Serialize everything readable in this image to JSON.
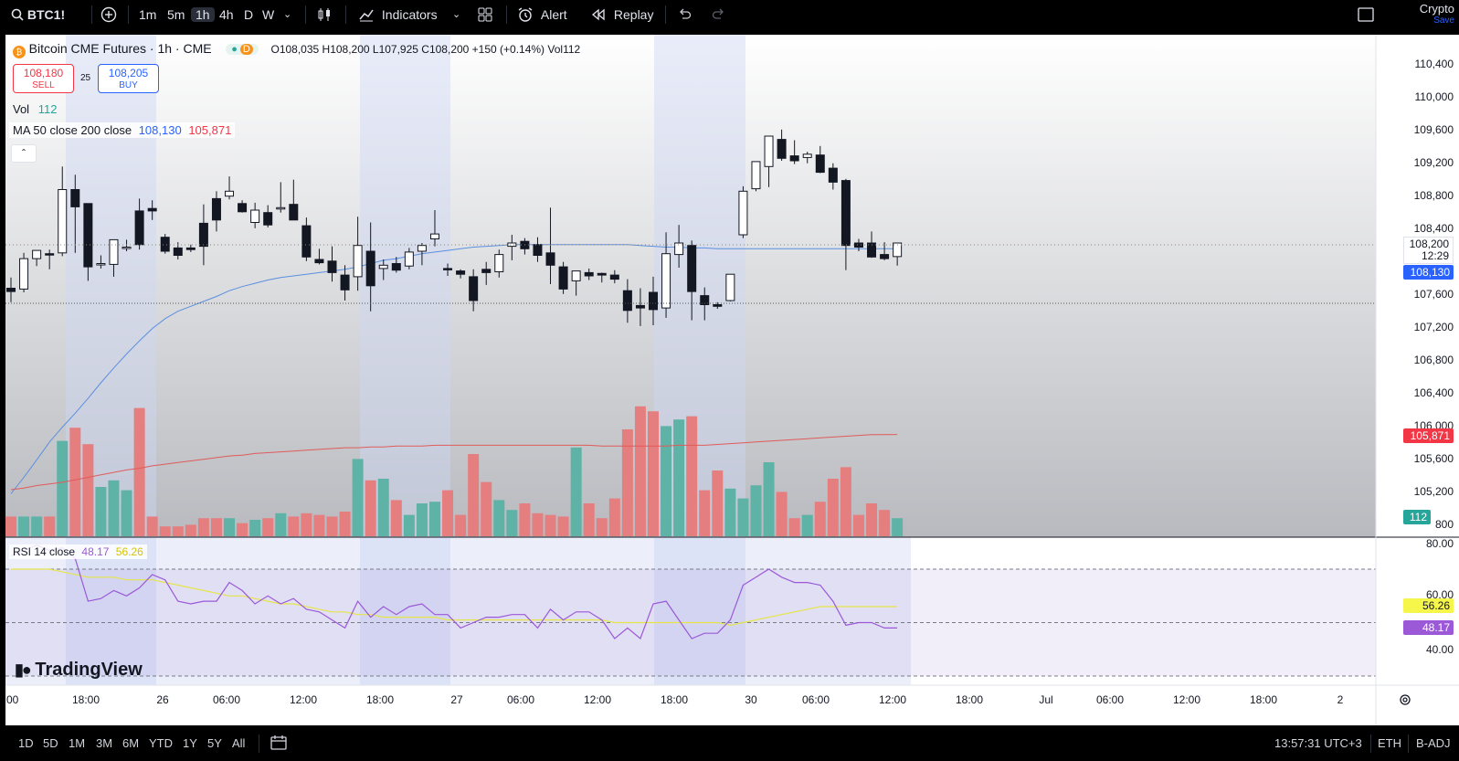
{
  "toolbar": {
    "symbol": "BTC1!",
    "timeframes": [
      "1m",
      "5m",
      "1h",
      "4h",
      "D",
      "W"
    ],
    "active_timeframe": "1h",
    "indicators_label": "Indicators",
    "alert_label": "Alert",
    "replay_label": "Replay",
    "crypto_label": "Crypto",
    "save_label": "Save"
  },
  "legend": {
    "title": "Bitcoin CME Futures · 1h · CME",
    "market_status": "D",
    "ohlc": "O108,035  H108,200  L107,925  C108,200  +150 (+0.14%)  Vol112",
    "sell_price": "108,180",
    "sell_label": "SELL",
    "spread": "25",
    "buy_price": "108,205",
    "buy_label": "BUY",
    "vol_label": "Vol",
    "vol_value": "112",
    "ma_label": "MA 50 close 200 close",
    "ma50_value": "108,130",
    "ma200_value": "105,871",
    "rsi_label": "RSI 14 close",
    "rsi_value": "48.17",
    "rsi_ma_value": "56.26"
  },
  "watermark": "TradingView",
  "price_axis": {
    "labels": [
      "110,400",
      "110,000",
      "109,600",
      "109,200",
      "108,800",
      "108,400",
      "107,600",
      "107,200",
      "106,800",
      "106,400",
      "106,000",
      "105,600",
      "105,200",
      "800"
    ],
    "last_price": "108,200",
    "countdown": "12:29",
    "ma50_tag": "108,130",
    "ma200_tag": "105,871",
    "vol_tag": "112"
  },
  "rsi_axis": {
    "labels": [
      "80.00",
      "60.00",
      "40.00"
    ],
    "rsi_ma_tag": "56.26",
    "rsi_tag": "48.17"
  },
  "time_axis": {
    "labels": [
      ":00",
      "18:00",
      "26",
      "06:00",
      "12:00",
      "18:00",
      "27",
      "06:00",
      "12:00",
      "18:00",
      "30",
      "06:00",
      "12:00",
      "18:00",
      "Jul",
      "06:00",
      "12:00",
      "18:00",
      "2"
    ]
  },
  "bottom": {
    "ranges": [
      "1D",
      "5D",
      "1M",
      "3M",
      "6M",
      "YTD",
      "1Y",
      "5Y",
      "All"
    ],
    "clock": "13:57:31 UTC+3",
    "session": "ETH",
    "adjust": "B-ADJ"
  },
  "colors": {
    "up_volume": "#5fb3a6",
    "down_volume": "#e57f7f",
    "ma50": "#5b8fe0",
    "ma200": "#e05b5b",
    "rsi": "#9b59d8",
    "rsi_ma": "#e5e54a"
  },
  "chart_data": {
    "type": "candlestick",
    "title": "Bitcoin CME Futures · 1h · CME",
    "ylim": [
      105800,
      110600
    ],
    "candles": [
      {
        "o": 107650,
        "h": 107780,
        "l": 107480,
        "c": 107610
      },
      {
        "o": 107640,
        "h": 108080,
        "l": 107600,
        "c": 108010
      },
      {
        "o": 108010,
        "h": 108100,
        "l": 107920,
        "c": 108110
      },
      {
        "o": 108070,
        "h": 108120,
        "l": 107880,
        "c": 108060
      },
      {
        "o": 108080,
        "h": 109130,
        "l": 108040,
        "c": 108850
      },
      {
        "o": 108850,
        "h": 109030,
        "l": 108080,
        "c": 108640
      },
      {
        "o": 108680,
        "h": 108650,
        "l": 107740,
        "c": 107910
      },
      {
        "o": 107940,
        "h": 108050,
        "l": 107890,
        "c": 107950
      },
      {
        "o": 107940,
        "h": 108170,
        "l": 107790,
        "c": 108240
      },
      {
        "o": 108150,
        "h": 108240,
        "l": 108100,
        "c": 108150
      },
      {
        "o": 108590,
        "h": 108740,
        "l": 108120,
        "c": 108180
      },
      {
        "o": 108620,
        "h": 108720,
        "l": 108480,
        "c": 108590
      },
      {
        "o": 108270,
        "h": 108310,
        "l": 108070,
        "c": 108100
      },
      {
        "o": 108140,
        "h": 108210,
        "l": 108000,
        "c": 108050
      },
      {
        "o": 108140,
        "h": 108180,
        "l": 108090,
        "c": 108120
      },
      {
        "o": 108440,
        "h": 108670,
        "l": 107930,
        "c": 108160
      },
      {
        "o": 108740,
        "h": 108830,
        "l": 108340,
        "c": 108480
      },
      {
        "o": 108770,
        "h": 109010,
        "l": 108730,
        "c": 108830
      },
      {
        "o": 108680,
        "h": 108720,
        "l": 108570,
        "c": 108580
      },
      {
        "o": 108450,
        "h": 108690,
        "l": 108380,
        "c": 108600
      },
      {
        "o": 108570,
        "h": 108660,
        "l": 108390,
        "c": 108420
      },
      {
        "o": 108620,
        "h": 108940,
        "l": 108570,
        "c": 108630
      },
      {
        "o": 108670,
        "h": 108970,
        "l": 108580,
        "c": 108480
      },
      {
        "o": 108410,
        "h": 108510,
        "l": 107980,
        "c": 108030
      },
      {
        "o": 108000,
        "h": 108130,
        "l": 107940,
        "c": 107960
      },
      {
        "o": 107980,
        "h": 108160,
        "l": 107730,
        "c": 107840
      },
      {
        "o": 107810,
        "h": 107930,
        "l": 107500,
        "c": 107630
      },
      {
        "o": 107790,
        "h": 108520,
        "l": 107620,
        "c": 108170
      },
      {
        "o": 108100,
        "h": 108450,
        "l": 107370,
        "c": 107680
      },
      {
        "o": 107890,
        "h": 108000,
        "l": 107750,
        "c": 107930
      },
      {
        "o": 107950,
        "h": 108030,
        "l": 107840,
        "c": 107870
      },
      {
        "o": 107920,
        "h": 108140,
        "l": 107880,
        "c": 108090
      },
      {
        "o": 108100,
        "h": 108200,
        "l": 107930,
        "c": 108170
      },
      {
        "o": 108250,
        "h": 108600,
        "l": 108160,
        "c": 108310
      },
      {
        "o": 107890,
        "h": 107950,
        "l": 107800,
        "c": 107880
      },
      {
        "o": 107860,
        "h": 107880,
        "l": 107770,
        "c": 107820
      },
      {
        "o": 107790,
        "h": 107880,
        "l": 107370,
        "c": 107500
      },
      {
        "o": 107880,
        "h": 107970,
        "l": 107690,
        "c": 107840
      },
      {
        "o": 107850,
        "h": 108120,
        "l": 107780,
        "c": 108060
      },
      {
        "o": 108160,
        "h": 108300,
        "l": 107990,
        "c": 108200
      },
      {
        "o": 108220,
        "h": 108260,
        "l": 108060,
        "c": 108130
      },
      {
        "o": 108180,
        "h": 108270,
        "l": 107970,
        "c": 108050
      },
      {
        "o": 108080,
        "h": 108630,
        "l": 107700,
        "c": 107930
      },
      {
        "o": 107910,
        "h": 107970,
        "l": 107580,
        "c": 107640
      },
      {
        "o": 107740,
        "h": 107760,
        "l": 107560,
        "c": 107860
      },
      {
        "o": 107840,
        "h": 107890,
        "l": 107750,
        "c": 107800
      },
      {
        "o": 107830,
        "h": 107840,
        "l": 107720,
        "c": 107810
      },
      {
        "o": 107810,
        "h": 107870,
        "l": 107710,
        "c": 107760
      },
      {
        "o": 107620,
        "h": 107760,
        "l": 107230,
        "c": 107380
      },
      {
        "o": 107440,
        "h": 107650,
        "l": 107190,
        "c": 107410
      },
      {
        "o": 107600,
        "h": 107790,
        "l": 107200,
        "c": 107390
      },
      {
        "o": 107410,
        "h": 108330,
        "l": 107290,
        "c": 108070
      },
      {
        "o": 108060,
        "h": 108420,
        "l": 107900,
        "c": 108200
      },
      {
        "o": 108170,
        "h": 108230,
        "l": 107260,
        "c": 107610
      },
      {
        "o": 107560,
        "h": 107660,
        "l": 107260,
        "c": 107450
      },
      {
        "o": 107450,
        "h": 107480,
        "l": 107400,
        "c": 107430
      },
      {
        "o": 107500,
        "h": 107750,
        "l": 107490,
        "c": 107820
      },
      {
        "o": 108300,
        "h": 108890,
        "l": 108260,
        "c": 108830
      },
      {
        "o": 108860,
        "h": 109180,
        "l": 108830,
        "c": 109190
      },
      {
        "o": 109130,
        "h": 109500,
        "l": 108880,
        "c": 109500
      },
      {
        "o": 109460,
        "h": 109580,
        "l": 109200,
        "c": 109230
      },
      {
        "o": 109260,
        "h": 109450,
        "l": 109160,
        "c": 109200
      },
      {
        "o": 109240,
        "h": 109310,
        "l": 109170,
        "c": 109280
      },
      {
        "o": 109270,
        "h": 109380,
        "l": 109050,
        "c": 109060
      },
      {
        "o": 109110,
        "h": 109170,
        "l": 108850,
        "c": 108940
      },
      {
        "o": 108960,
        "h": 108980,
        "l": 107870,
        "c": 108170
      },
      {
        "o": 108200,
        "h": 108250,
        "l": 108100,
        "c": 108150
      },
      {
        "o": 108200,
        "h": 108340,
        "l": 108020,
        "c": 108030
      },
      {
        "o": 108060,
        "h": 108210,
        "l": 107990,
        "c": 108010
      },
      {
        "o": 108035,
        "h": 108200,
        "l": 107925,
        "c": 108200
      }
    ],
    "volume": [
      12,
      12,
      12,
      12,
      58,
      66,
      56,
      30,
      34,
      28,
      78,
      12,
      6,
      6,
      7,
      11,
      11,
      11,
      8,
      10,
      11,
      14,
      12,
      14,
      13,
      12,
      15,
      47,
      34,
      35,
      22,
      13,
      20,
      21,
      28,
      13,
      50,
      33,
      22,
      16,
      20,
      14,
      13,
      12,
      54,
      20,
      11,
      23,
      65,
      79,
      76,
      67,
      71,
      73,
      28,
      40,
      29,
      23,
      31,
      45,
      27,
      11,
      13,
      21,
      35,
      42,
      13,
      20,
      16,
      11
    ],
    "ma50": [
      105150,
      105350,
      105560,
      105780,
      105960,
      106130,
      106310,
      106500,
      106680,
      106850,
      107010,
      107160,
      107280,
      107370,
      107430,
      107490,
      107550,
      107620,
      107670,
      107710,
      107750,
      107780,
      107800,
      107820,
      107840,
      107860,
      107880,
      107910,
      107950,
      107990,
      108010,
      108040,
      108070,
      108090,
      108110,
      108130,
      108150,
      108160,
      108170,
      108180,
      108180,
      108180,
      108180,
      108180,
      108180,
      108180,
      108180,
      108180,
      108180,
      108170,
      108160,
      108150,
      108150,
      108140,
      108140,
      108130,
      108130,
      108130,
      108130,
      108130,
      108130,
      108130,
      108130,
      108130,
      108130,
      108130,
      108130,
      108130,
      108130,
      108130
    ],
    "ma200": [
      105200,
      105220,
      105250,
      105270,
      105290,
      105320,
      105350,
      105380,
      105410,
      105440,
      105460,
      105490,
      105510,
      105530,
      105550,
      105570,
      105590,
      105610,
      105620,
      105640,
      105650,
      105660,
      105670,
      105680,
      105690,
      105700,
      105710,
      105710,
      105720,
      105720,
      105730,
      105730,
      105730,
      105740,
      105740,
      105740,
      105740,
      105740,
      105740,
      105740,
      105740,
      105740,
      105740,
      105740,
      105740,
      105740,
      105730,
      105730,
      105730,
      105730,
      105730,
      105730,
      105740,
      105740,
      105740,
      105750,
      105760,
      105770,
      105780,
      105790,
      105800,
      105810,
      105820,
      105830,
      105840,
      105850,
      105860,
      105870,
      105870,
      105871
    ],
    "rsi": [
      75,
      77,
      79,
      77,
      78,
      74,
      58,
      59,
      62,
      60,
      63,
      68,
      66,
      58,
      57,
      58,
      58,
      65,
      62,
      57,
      60,
      57,
      59,
      55,
      54,
      51,
      48,
      58,
      52,
      56,
      53,
      56,
      57,
      53,
      53,
      48,
      50,
      52,
      52,
      53,
      53,
      48,
      55,
      51,
      54,
      54,
      51,
      44,
      48,
      44,
      57,
      58,
      51,
      44,
      46,
      46,
      51,
      64,
      67,
      70,
      67,
      65,
      65,
      64,
      58,
      49,
      50,
      50,
      48,
      48
    ],
    "rsi_ma": [
      70,
      70,
      70,
      70,
      69,
      68,
      67,
      67,
      67,
      66,
      66,
      66,
      65,
      64,
      63,
      62,
      61,
      60,
      60,
      59,
      58,
      57,
      57,
      56,
      55,
      54,
      54,
      53,
      53,
      52,
      52,
      52,
      52,
      52,
      51,
      51,
      51,
      51,
      51,
      51,
      51,
      51,
      51,
      51,
      51,
      51,
      51,
      50,
      50,
      50,
      50,
      50,
      50,
      50,
      50,
      50,
      49,
      50,
      51,
      52,
      53,
      54,
      55,
      56,
      56,
      56,
      56,
      56,
      56,
      56
    ],
    "rsi_levels": [
      70,
      50,
      30
    ]
  }
}
